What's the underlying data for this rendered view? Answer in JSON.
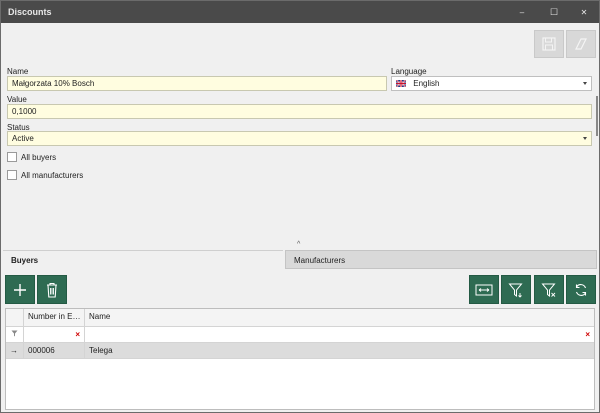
{
  "window": {
    "title": "Discounts",
    "minimize_glyph": "–",
    "maximize_glyph": "☐",
    "close_glyph": "✕"
  },
  "toolbar": {
    "save_icon": "save-icon",
    "clear_icon": "eraser-icon"
  },
  "form": {
    "name_label": "Name",
    "name_value": "Małgorzata 10% Bosch",
    "language_label": "Language",
    "language_value": "English",
    "language_flag": "uk-flag-icon",
    "value_label": "Value",
    "value_value": "0,1000",
    "status_label": "Status",
    "status_value": "Active",
    "all_buyers_label": "All buyers",
    "all_buyers_checked": false,
    "all_manufacturers_label": "All manufacturers",
    "all_manufacturers_checked": false
  },
  "tabs": [
    {
      "label": "Buyers",
      "active": true
    },
    {
      "label": "Manufacturers",
      "active": false
    }
  ],
  "grid_buttons": {
    "left": [
      "add-icon",
      "trash-icon"
    ],
    "right": [
      "fit-columns-icon",
      "filter-add-icon",
      "filter-clear-icon",
      "refresh-icon"
    ]
  },
  "grid": {
    "columns": [
      "Number in E…",
      "Name"
    ],
    "filter_clear_glyph": "×",
    "rows": [
      {
        "indicator": "→",
        "number": "000006",
        "name": "Telega"
      }
    ]
  },
  "colors": {
    "titlebar": "#4a4a4a",
    "accent_green": "#2e6b52",
    "required_field": "#fffde0",
    "selected_row": "#dcdcdc"
  }
}
